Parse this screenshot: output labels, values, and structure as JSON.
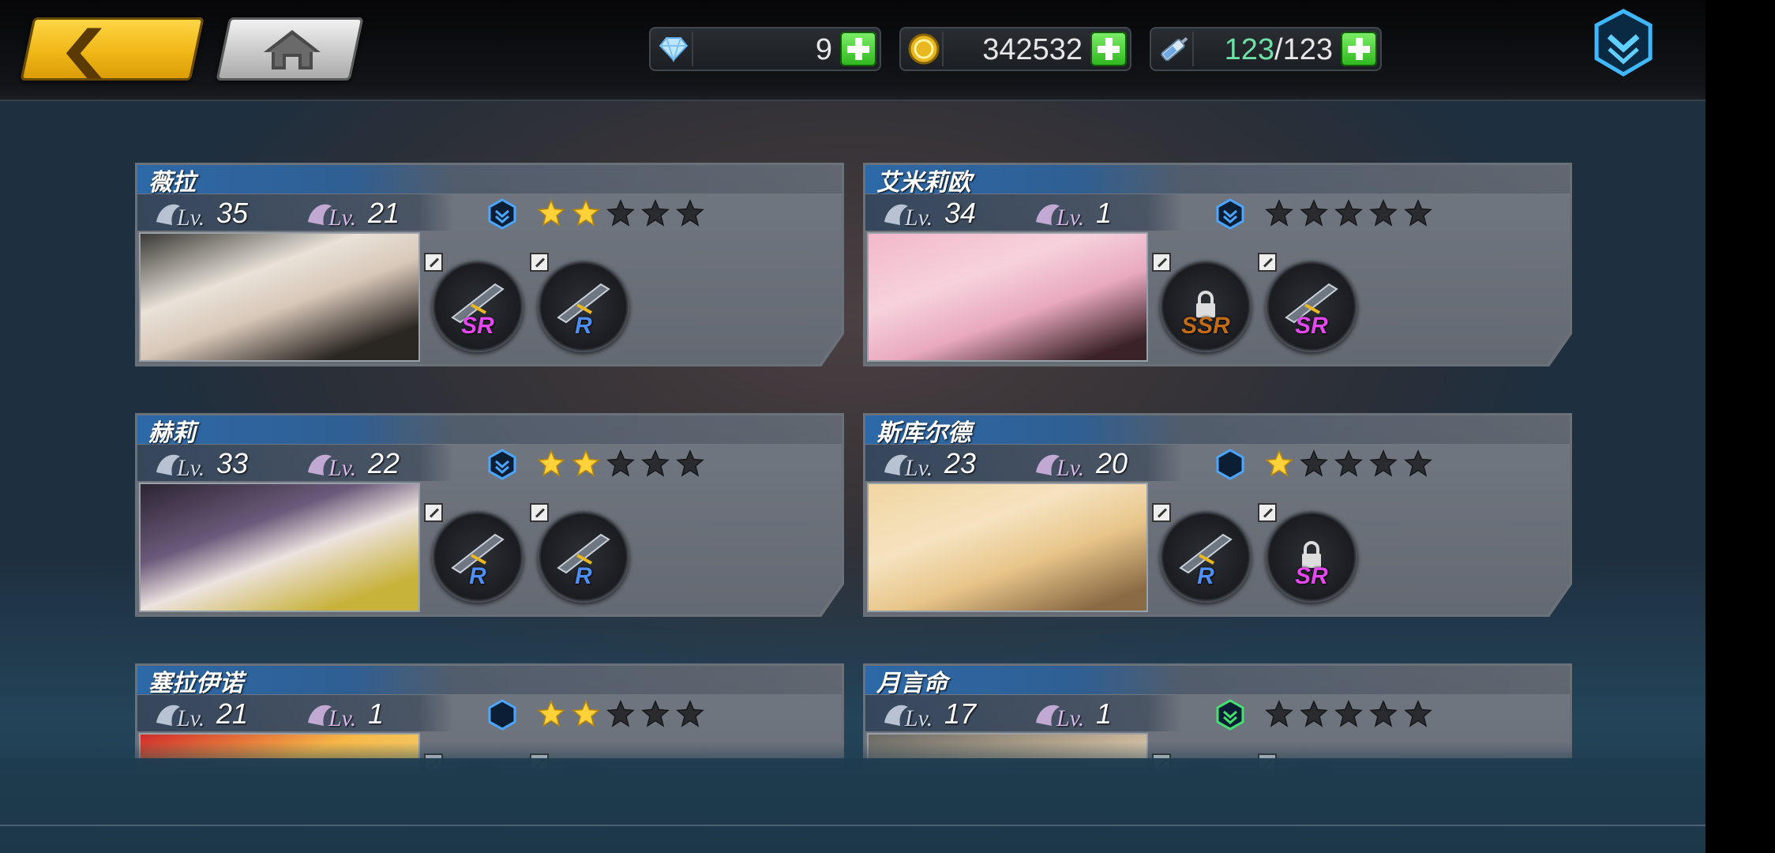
{
  "topbar": {
    "back_icon": "back-arrow-icon",
    "home_icon": "home-icon",
    "menu_icon": "chevron-down-menu-icon",
    "resources": [
      {
        "name": "diamonds",
        "icon": "diamond-icon",
        "value": "9"
      },
      {
        "name": "gold",
        "icon": "gold-coin-icon",
        "value": "342532"
      },
      {
        "name": "energy",
        "icon": "energy-syringe-icon",
        "current": "123",
        "sep": "/",
        "max": "123"
      }
    ]
  },
  "colors": {
    "accent_gold": "#f0b716",
    "name_bar_blue": "#2d69a8",
    "plus_green": "#2db51c",
    "energy_green": "#6ee0a6",
    "rarity_SR": "#e548f0",
    "rarity_R": "#4e8ff5",
    "rarity_SSR": "#c46b18"
  },
  "characters": [
    {
      "name": "薇拉",
      "level_prefix": "Lv.",
      "level": "35",
      "gear_prefix": "Lv.",
      "gear_level": "21",
      "rank_icon": "rank-chevron-blue-icon",
      "stars_filled": 2,
      "stars_total": 5,
      "equipment": [
        {
          "rarity": "SR",
          "locked": false,
          "icon": "death-grenade-icon"
        },
        {
          "rarity": "R",
          "locked": false,
          "icon": "horn-gun-icon"
        }
      ]
    },
    {
      "name": "艾米莉欧",
      "level_prefix": "Lv.",
      "level": "34",
      "gear_prefix": "Lv.",
      "gear_level": "1",
      "rank_icon": "rank-chevron-blue-icon",
      "stars_filled": 0,
      "stars_total": 5,
      "equipment": [
        {
          "rarity": "SSR",
          "locked": true,
          "icon": "locked-weapon-icon"
        },
        {
          "rarity": "SR",
          "locked": false,
          "icon": "bow-weapon-icon"
        }
      ]
    },
    {
      "name": "赫莉",
      "level_prefix": "Lv.",
      "level": "33",
      "gear_prefix": "Lv.",
      "gear_level": "22",
      "rank_icon": "rank-chevron-blue-icon",
      "stars_filled": 2,
      "stars_total": 5,
      "equipment": [
        {
          "rarity": "R",
          "locked": false,
          "icon": "rifle-icon"
        },
        {
          "rarity": "R",
          "locked": false,
          "icon": "blade-icon"
        }
      ]
    },
    {
      "name": "斯库尔德",
      "level_prefix": "Lv.",
      "level": "23",
      "gear_prefix": "Lv.",
      "gear_level": "20",
      "rank_icon": "rank-hexagon-blue-icon",
      "stars_filled": 1,
      "stars_total": 5,
      "equipment": [
        {
          "rarity": "R",
          "locked": false,
          "icon": "staff-icon"
        },
        {
          "rarity": "SR",
          "locked": true,
          "icon": "locked-weapon-icon"
        }
      ]
    },
    {
      "name": "塞拉伊诺",
      "level_prefix": "Lv.",
      "level": "21",
      "gear_prefix": "Lv.",
      "gear_level": "1",
      "rank_icon": "rank-hexagon-blue-icon",
      "stars_filled": 2,
      "stars_total": 5,
      "equipment": [
        {
          "rarity": "",
          "locked": false,
          "icon": "weapon-icon"
        },
        {
          "rarity": "",
          "locked": false,
          "icon": "weapon-icon"
        }
      ]
    },
    {
      "name": "月言命",
      "level_prefix": "Lv.",
      "level": "17",
      "gear_prefix": "Lv.",
      "gear_level": "1",
      "rank_icon": "rank-chevron-green-icon",
      "stars_filled": 0,
      "stars_total": 5,
      "equipment": [
        {
          "rarity": "",
          "locked": false,
          "icon": "weapon-icon"
        },
        {
          "rarity": "",
          "locked": false,
          "icon": "weapon-icon"
        }
      ]
    }
  ]
}
